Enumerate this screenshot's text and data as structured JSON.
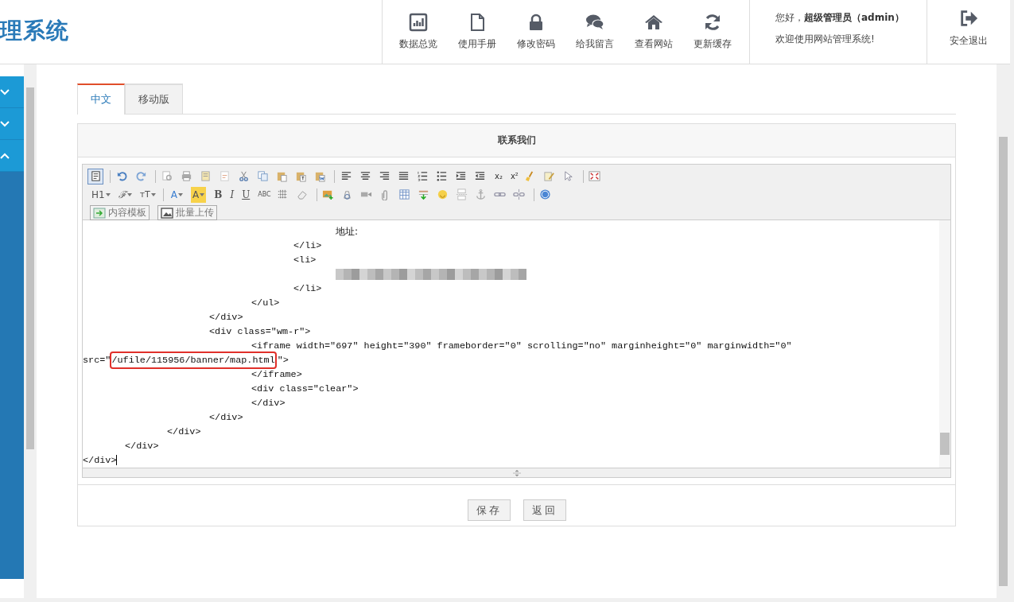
{
  "header": {
    "logo": "理系统",
    "nav": [
      {
        "label": "数据总览"
      },
      {
        "label": "使用手册"
      },
      {
        "label": "修改密码"
      },
      {
        "label": "给我留言"
      },
      {
        "label": "查看网站"
      },
      {
        "label": "更新缓存"
      }
    ],
    "greeting": "您好，**超级管理员（admin）**",
    "welcome": "欢迎使用网站管理系统!",
    "logout": "安全退出"
  },
  "sidebar": {
    "items": [
      {
        "expanded": false
      },
      {
        "expanded": false
      },
      {
        "expanded": true
      }
    ]
  },
  "tabs": [
    {
      "label": "中文",
      "selected": true
    },
    {
      "label": "移动版",
      "selected": false
    }
  ],
  "panel_title": "联系我们",
  "editor": {
    "source_mode": true,
    "toolbar_labels": [
      "x₂",
      "x²",
      "H1",
      "ℱ",
      "ᴛT",
      "A",
      "A",
      "B",
      "I",
      "U",
      "ABC"
    ],
    "toolbar_buttons": [
      "内容模板",
      "批量上传"
    ],
    "lines": [
      {
        "kind": "zh",
        "text": "\t\t\t\t\t\t地址:"
      },
      {
        "kind": "code",
        "text": "\t\t\t\t\t</li>"
      },
      {
        "kind": "code",
        "text": "\t\t\t\t\t<li>"
      },
      {
        "kind": "redacted"
      },
      {
        "kind": "code",
        "text": "\t\t\t\t\t</li>"
      },
      {
        "kind": "code",
        "text": "\t\t\t\t</ul>"
      },
      {
        "kind": "code",
        "text": "\t\t\t</div>"
      },
      {
        "kind": "code",
        "text": "\t\t\t<div class=\"wm-r\">"
      },
      {
        "kind": "code",
        "text": "\t\t\t\t<iframe width=\"697\" height=\"390\" frameborder=\"0\" scrolling=\"no\" marginheight=\"0\" marginwidth=\"0\""
      },
      {
        "kind": "marked",
        "before": "src=\"",
        "highlight": "/ufile/115956/banner/map.html",
        "after": "\">"
      },
      {
        "kind": "code",
        "text": "\t\t\t\t</iframe>"
      },
      {
        "kind": "code",
        "text": "\t\t\t\t<div class=\"clear\">"
      },
      {
        "kind": "code",
        "text": "\t\t\t\t</div>"
      },
      {
        "kind": "code",
        "text": "\t\t\t</div>"
      },
      {
        "kind": "code",
        "text": "\t\t</div>"
      },
      {
        "kind": "code",
        "text": "\t</div>"
      },
      {
        "kind": "code",
        "text": "</div>",
        "cursor": true
      }
    ]
  },
  "buttons": [
    {
      "label": "保存"
    },
    {
      "label": "返回"
    }
  ]
}
